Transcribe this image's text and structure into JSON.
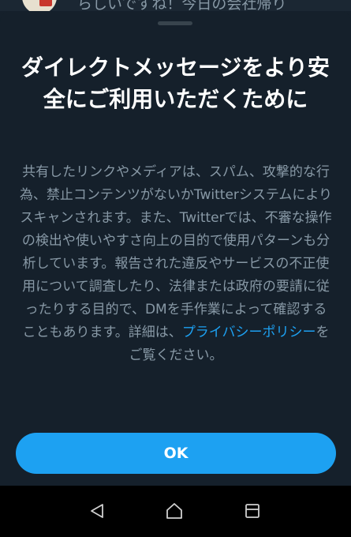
{
  "background_post": {
    "text": "らしいですね！今日の会社帰り"
  },
  "dialog": {
    "title": "ダイレクトメッセージをより安全にご利用いただくために",
    "body_before_link": "共有したリンクやメディアは、スパム、攻撃的な行為、禁止コンテンツがないかTwitterシステムによりスキャンされます。また、Twitterでは、不審な操作の検出や使いやすさ向上の目的で使用パターンも分析しています。報告された違反やサービスの不正使用について調査したり、法律または政府の要請に従ったりする目的で、DMを手作業によって確認することもあります。詳細は、",
    "link_text": "プライバシーポリシー",
    "body_after_link": "をご覧ください。",
    "ok_label": "OK"
  },
  "navbar": {
    "back_icon": "back-triangle-icon",
    "home_icon": "home-icon",
    "recent_icon": "recent-apps-icon"
  },
  "colors": {
    "background": "#15202b",
    "accent": "#1da1f2",
    "secondary_text": "#8899a6",
    "title_text": "#ffffff",
    "navbar": "#000000"
  }
}
